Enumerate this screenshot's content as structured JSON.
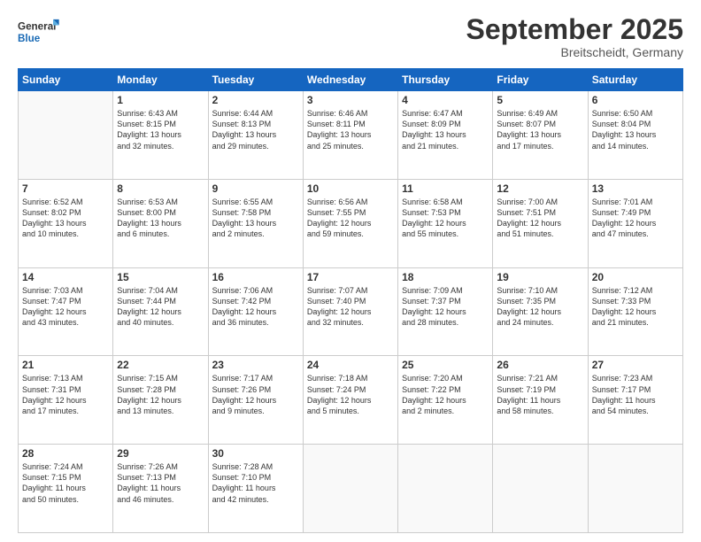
{
  "header": {
    "logo_general": "General",
    "logo_blue": "Blue",
    "month": "September 2025",
    "location": "Breitscheidt, Germany"
  },
  "days_of_week": [
    "Sunday",
    "Monday",
    "Tuesday",
    "Wednesday",
    "Thursday",
    "Friday",
    "Saturday"
  ],
  "weeks": [
    [
      {
        "day": "",
        "info": ""
      },
      {
        "day": "1",
        "info": "Sunrise: 6:43 AM\nSunset: 8:15 PM\nDaylight: 13 hours\nand 32 minutes."
      },
      {
        "day": "2",
        "info": "Sunrise: 6:44 AM\nSunset: 8:13 PM\nDaylight: 13 hours\nand 29 minutes."
      },
      {
        "day": "3",
        "info": "Sunrise: 6:46 AM\nSunset: 8:11 PM\nDaylight: 13 hours\nand 25 minutes."
      },
      {
        "day": "4",
        "info": "Sunrise: 6:47 AM\nSunset: 8:09 PM\nDaylight: 13 hours\nand 21 minutes."
      },
      {
        "day": "5",
        "info": "Sunrise: 6:49 AM\nSunset: 8:07 PM\nDaylight: 13 hours\nand 17 minutes."
      },
      {
        "day": "6",
        "info": "Sunrise: 6:50 AM\nSunset: 8:04 PM\nDaylight: 13 hours\nand 14 minutes."
      }
    ],
    [
      {
        "day": "7",
        "info": "Sunrise: 6:52 AM\nSunset: 8:02 PM\nDaylight: 13 hours\nand 10 minutes."
      },
      {
        "day": "8",
        "info": "Sunrise: 6:53 AM\nSunset: 8:00 PM\nDaylight: 13 hours\nand 6 minutes."
      },
      {
        "day": "9",
        "info": "Sunrise: 6:55 AM\nSunset: 7:58 PM\nDaylight: 13 hours\nand 2 minutes."
      },
      {
        "day": "10",
        "info": "Sunrise: 6:56 AM\nSunset: 7:55 PM\nDaylight: 12 hours\nand 59 minutes."
      },
      {
        "day": "11",
        "info": "Sunrise: 6:58 AM\nSunset: 7:53 PM\nDaylight: 12 hours\nand 55 minutes."
      },
      {
        "day": "12",
        "info": "Sunrise: 7:00 AM\nSunset: 7:51 PM\nDaylight: 12 hours\nand 51 minutes."
      },
      {
        "day": "13",
        "info": "Sunrise: 7:01 AM\nSunset: 7:49 PM\nDaylight: 12 hours\nand 47 minutes."
      }
    ],
    [
      {
        "day": "14",
        "info": "Sunrise: 7:03 AM\nSunset: 7:47 PM\nDaylight: 12 hours\nand 43 minutes."
      },
      {
        "day": "15",
        "info": "Sunrise: 7:04 AM\nSunset: 7:44 PM\nDaylight: 12 hours\nand 40 minutes."
      },
      {
        "day": "16",
        "info": "Sunrise: 7:06 AM\nSunset: 7:42 PM\nDaylight: 12 hours\nand 36 minutes."
      },
      {
        "day": "17",
        "info": "Sunrise: 7:07 AM\nSunset: 7:40 PM\nDaylight: 12 hours\nand 32 minutes."
      },
      {
        "day": "18",
        "info": "Sunrise: 7:09 AM\nSunset: 7:37 PM\nDaylight: 12 hours\nand 28 minutes."
      },
      {
        "day": "19",
        "info": "Sunrise: 7:10 AM\nSunset: 7:35 PM\nDaylight: 12 hours\nand 24 minutes."
      },
      {
        "day": "20",
        "info": "Sunrise: 7:12 AM\nSunset: 7:33 PM\nDaylight: 12 hours\nand 21 minutes."
      }
    ],
    [
      {
        "day": "21",
        "info": "Sunrise: 7:13 AM\nSunset: 7:31 PM\nDaylight: 12 hours\nand 17 minutes."
      },
      {
        "day": "22",
        "info": "Sunrise: 7:15 AM\nSunset: 7:28 PM\nDaylight: 12 hours\nand 13 minutes."
      },
      {
        "day": "23",
        "info": "Sunrise: 7:17 AM\nSunset: 7:26 PM\nDaylight: 12 hours\nand 9 minutes."
      },
      {
        "day": "24",
        "info": "Sunrise: 7:18 AM\nSunset: 7:24 PM\nDaylight: 12 hours\nand 5 minutes."
      },
      {
        "day": "25",
        "info": "Sunrise: 7:20 AM\nSunset: 7:22 PM\nDaylight: 12 hours\nand 2 minutes."
      },
      {
        "day": "26",
        "info": "Sunrise: 7:21 AM\nSunset: 7:19 PM\nDaylight: 11 hours\nand 58 minutes."
      },
      {
        "day": "27",
        "info": "Sunrise: 7:23 AM\nSunset: 7:17 PM\nDaylight: 11 hours\nand 54 minutes."
      }
    ],
    [
      {
        "day": "28",
        "info": "Sunrise: 7:24 AM\nSunset: 7:15 PM\nDaylight: 11 hours\nand 50 minutes."
      },
      {
        "day": "29",
        "info": "Sunrise: 7:26 AM\nSunset: 7:13 PM\nDaylight: 11 hours\nand 46 minutes."
      },
      {
        "day": "30",
        "info": "Sunrise: 7:28 AM\nSunset: 7:10 PM\nDaylight: 11 hours\nand 42 minutes."
      },
      {
        "day": "",
        "info": ""
      },
      {
        "day": "",
        "info": ""
      },
      {
        "day": "",
        "info": ""
      },
      {
        "day": "",
        "info": ""
      }
    ]
  ]
}
